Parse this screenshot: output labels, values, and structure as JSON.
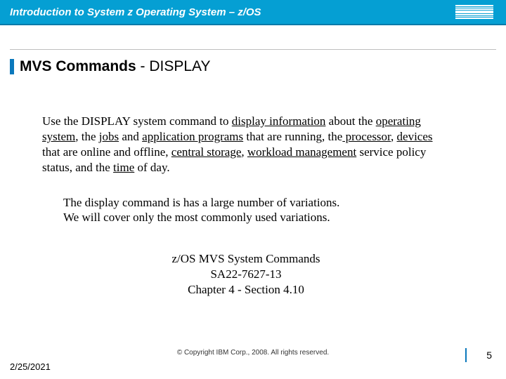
{
  "header": {
    "title": "Introduction to System z Operating System – z/OS",
    "logo_label": "IBM"
  },
  "slide": {
    "title_bold": "MVS Commands",
    "title_rest": " - DISPLAY"
  },
  "body": {
    "p1_pre": "Use the DISPLAY system command to ",
    "p1_u1": "display information",
    "p1_t1": " about the ",
    "p1_u2": "operating system",
    "p1_t2": ", the ",
    "p1_u3": "jobs",
    "p1_t3": " and ",
    "p1_u4": "application programs",
    "p1_t4": " that are running, the",
    "p1_u5": " processor",
    "p1_t5": ", ",
    "p1_u6": "devices",
    "p1_t6": " that are online and offline, ",
    "p1_u7": "central storage",
    "p1_t7": ", ",
    "p1_u8": "workload management",
    "p1_t8": " service policy status, and the ",
    "p1_u9": "time",
    "p1_t9": " of day.",
    "p2_l1": "The display command is has a large number of variations.",
    "p2_l2": "We will cover only the most commonly used variations.",
    "p3_l1": "z/OS MVS System Commands",
    "p3_l2": "SA22-7627-13",
    "p3_l3": "Chapter 4 - Section 4.10"
  },
  "footer": {
    "date": "2/25/2021",
    "copyright": "© Copyright IBM Corp., 2008. All rights reserved.",
    "page": "5"
  }
}
